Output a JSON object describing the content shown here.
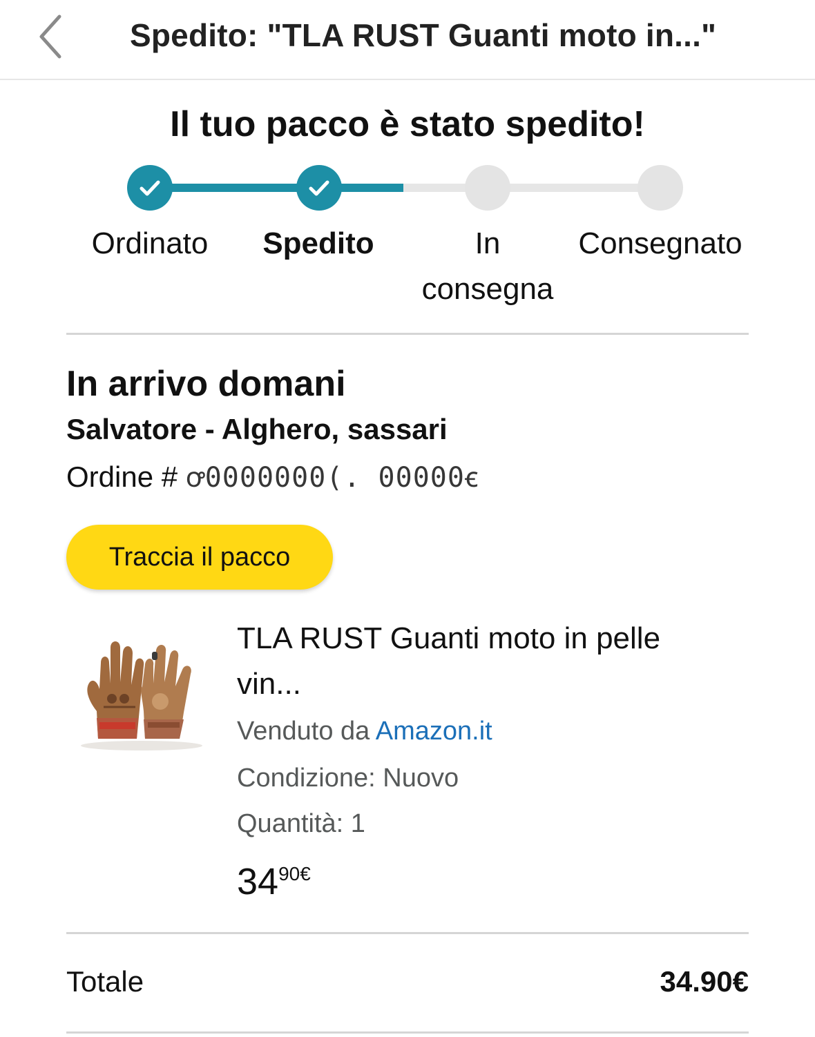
{
  "header": {
    "title": "Spedito: \"TLA RUST Guanti moto in...\"",
    "back_icon": "chevron-left-icon"
  },
  "status": {
    "headline": "Il tuo pacco è stato spedito!"
  },
  "progress": {
    "steps": [
      {
        "label": "Ordinato",
        "done": true
      },
      {
        "label": "Spedito",
        "done": true,
        "active": true
      },
      {
        "label_line1": "In",
        "label_line2": "consegna",
        "done": false
      },
      {
        "label": "Consegnato",
        "done": false
      }
    ],
    "accent_color": "#1d8fa6",
    "inactive_color": "#e4e4e4"
  },
  "delivery": {
    "arrival": "In arrivo domani",
    "recipient": "Salvatore - Alghero, sassari",
    "order_label": "Ordine #",
    "order_number": "ꝍ0000000(. 00000ꞓ"
  },
  "actions": {
    "track_label": "Traccia il pacco",
    "track_color": "#ffd814"
  },
  "product": {
    "title_line1": "TLA RUST Guanti moto in pelle",
    "title_line2": "vin...",
    "sold_by_label": "Venduto da",
    "seller": "Amazon.it",
    "condition": "Condizione: Nuovo",
    "quantity": "Quantità: 1",
    "price_whole": "34",
    "price_fraction": "90€",
    "image_icon": "leather-gloves-image"
  },
  "summary": {
    "total_label": "Totale",
    "total_value": "34.90€"
  }
}
